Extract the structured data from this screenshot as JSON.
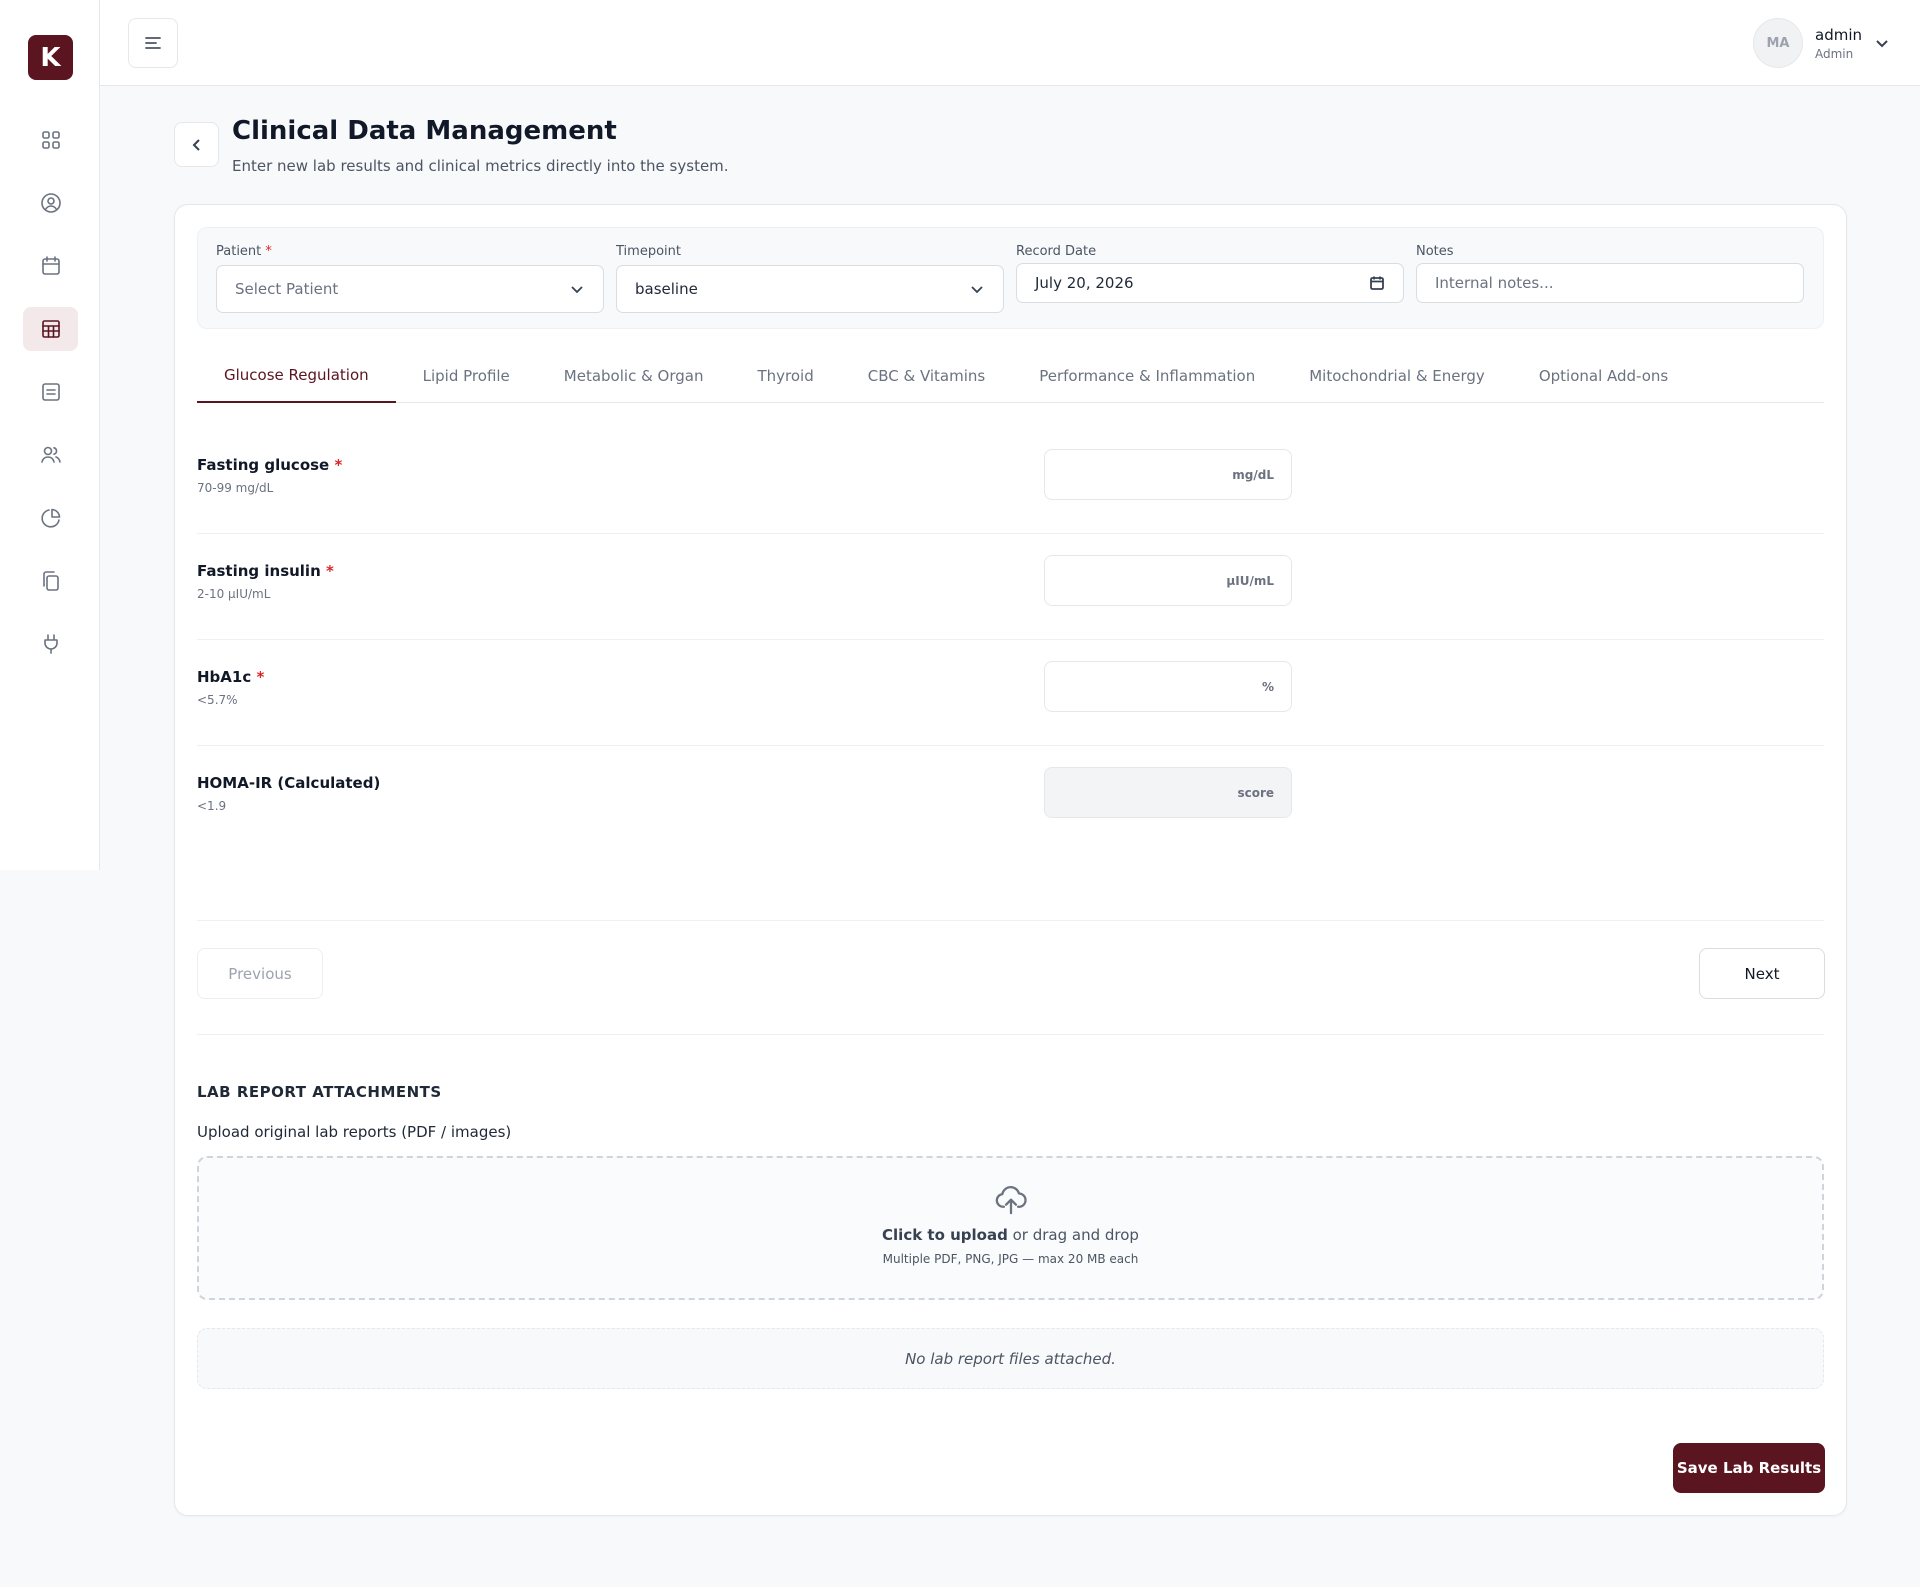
{
  "app": {
    "logo_letter": "K"
  },
  "sidebar": {
    "items": [
      {
        "icon": "dashboard-icon"
      },
      {
        "icon": "user-circle-icon"
      },
      {
        "icon": "calendar-icon"
      },
      {
        "icon": "table-icon",
        "active": true
      },
      {
        "icon": "document-icon"
      },
      {
        "icon": "users-icon"
      },
      {
        "icon": "pie-chart-icon"
      },
      {
        "icon": "copy-icon"
      },
      {
        "icon": "plug-icon"
      }
    ]
  },
  "header": {
    "avatar_initials": "MA",
    "user_name": "admin",
    "user_role": "Admin"
  },
  "page": {
    "title": "Clinical Data Management",
    "subtitle": "Enter new lab results and clinical metrics directly into the system."
  },
  "filters": {
    "patient": {
      "label": "Patient",
      "required_mark": "*",
      "placeholder": "Select Patient"
    },
    "timepoint": {
      "label": "Timepoint",
      "value": "baseline"
    },
    "record_date": {
      "label": "Record Date",
      "value": "July 20, 2026"
    },
    "notes": {
      "label": "Notes",
      "placeholder": "Internal notes..."
    }
  },
  "tabs": [
    {
      "label": "Glucose Regulation",
      "active": true
    },
    {
      "label": "Lipid Profile"
    },
    {
      "label": "Metabolic & Organ"
    },
    {
      "label": "Thyroid"
    },
    {
      "label": "CBC & Vitamins"
    },
    {
      "label": "Performance & Inflammation"
    },
    {
      "label": "Mitochondrial & Energy"
    },
    {
      "label": "Optional Add-ons"
    }
  ],
  "metrics": [
    {
      "name": "Fasting glucose",
      "required_mark": "*",
      "range": "70-99 mg/dL",
      "unit": "mg/dL"
    },
    {
      "name": "Fasting insulin",
      "required_mark": "*",
      "range": "2-10 μIU/mL",
      "unit": "μIU/mL"
    },
    {
      "name": "HbA1c",
      "required_mark": "*",
      "range": "<5.7%",
      "unit": "%"
    },
    {
      "name": "HOMA-IR (Calculated)",
      "required_mark": "",
      "range": "<1.9",
      "unit": "score",
      "disabled": true
    }
  ],
  "nav_buttons": {
    "previous": "Previous",
    "next": "Next"
  },
  "attachments": {
    "section_title": "LAB REPORT ATTACHMENTS",
    "upload_label": "Upload original lab reports (PDF / images)",
    "dropzone_action": "Click to upload",
    "dropzone_rest": " or drag and drop",
    "dropzone_hint": "Multiple PDF, PNG, JPG — max 20 MB each",
    "empty_text": "No lab report files attached."
  },
  "save_button": "Save Lab Results",
  "colors": {
    "brand": "#5a1521",
    "required": "#dc2626"
  }
}
